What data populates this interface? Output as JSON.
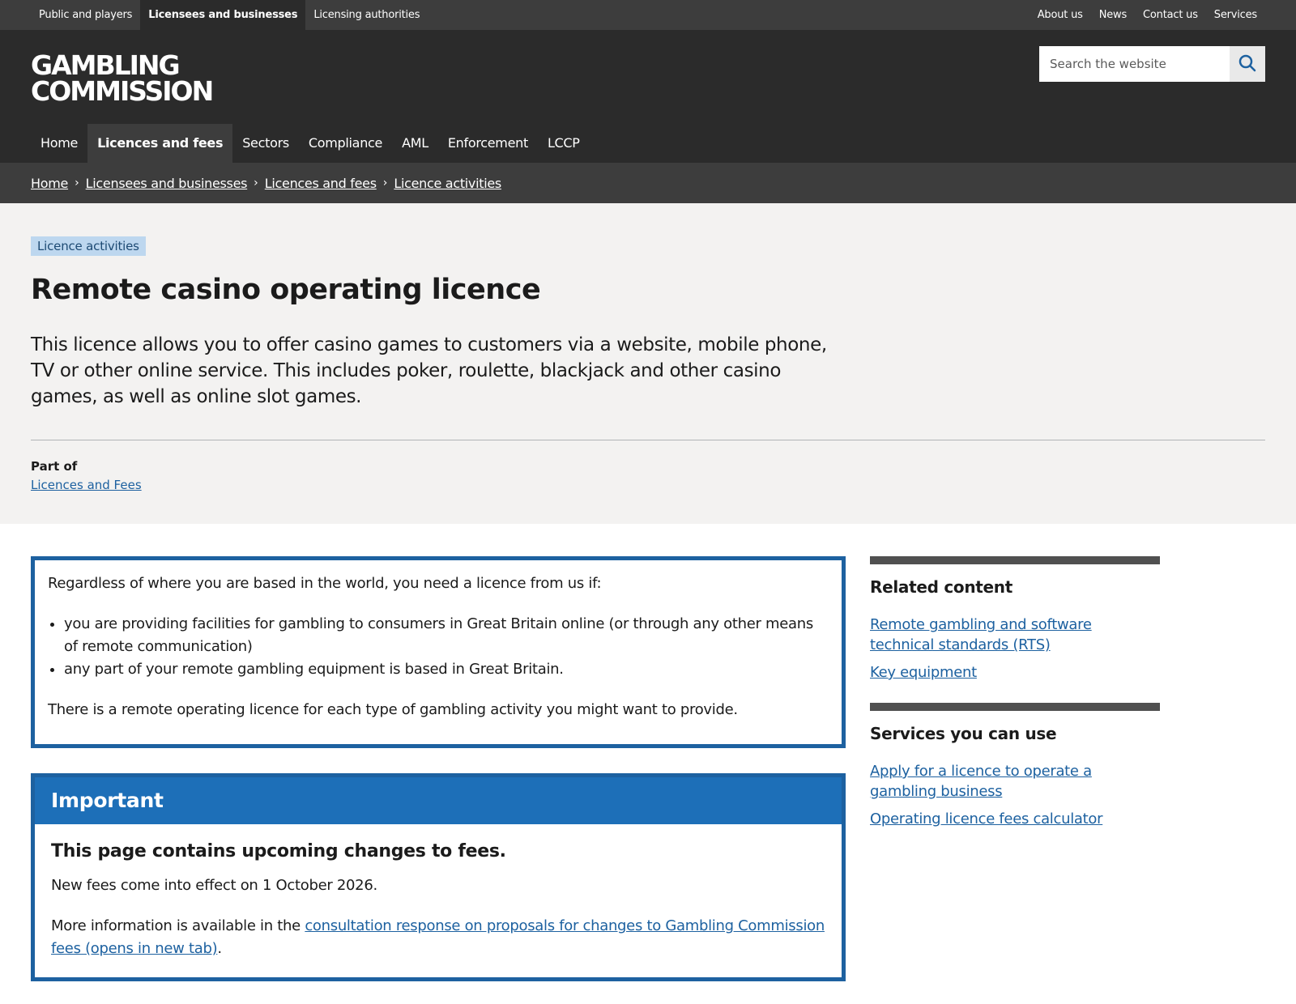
{
  "utility_nav": {
    "left": [
      "Public and players",
      "Licensees and businesses",
      "Licensing authorities"
    ],
    "right": [
      "About us",
      "News",
      "Contact us",
      "Services"
    ]
  },
  "logo": {
    "line1": "GAMBLING",
    "line2": "COMMISSION"
  },
  "search": {
    "placeholder": "Search the website"
  },
  "main_nav": [
    "Home",
    "Licences and fees",
    "Sectors",
    "Compliance",
    "AML",
    "Enforcement",
    "LCCP"
  ],
  "breadcrumb": [
    "Home",
    "Licensees and businesses",
    "Licences and fees",
    "Licence activities"
  ],
  "hero": {
    "tag": "Licence activities",
    "title": "Remote casino operating licence",
    "lede": "This licence allows you to offer casino games to customers via a website, mobile phone, TV or other online service. This includes poker, roulette, blackjack and other casino games, as well as online slot games.",
    "part_of_label": "Part of",
    "part_of_link": "Licences and Fees"
  },
  "info_box": {
    "intro": "Regardless of where you are based in the world, you need a licence from us if:",
    "bullets": [
      "you are providing facilities for gambling to consumers in Great Britain online (or through any other means of remote communication)",
      "any part of your remote gambling equipment is based in Great Britain."
    ],
    "outro": "There is a remote operating licence for each type of gambling activity you might want to provide."
  },
  "important": {
    "heading": "Important",
    "subheading": "This page contains upcoming changes to fees.",
    "text1": "New fees come into effect on 1 October 2026.",
    "text2_prefix": "More information is available in the ",
    "text2_link": "consultation response on proposals for changes to Gambling Commission fees (opens in new tab)",
    "text2_suffix": "."
  },
  "sidebar": {
    "related_heading": "Related content",
    "related_links": [
      "Remote gambling and software technical standards (RTS)",
      "Key equipment"
    ],
    "services_heading": "Services you can use",
    "services_links": [
      "Apply for a licence to operate a gambling business",
      "Operating licence fees calculator"
    ]
  },
  "colors": {
    "header_bg": "#2b2b2b",
    "utility_bg": "#3d3d3d",
    "accent_blue": "#1d6fb8",
    "link": "#1d61a0",
    "hero_bg": "#f3f2f1",
    "tag_bg": "#bdd7ef"
  }
}
